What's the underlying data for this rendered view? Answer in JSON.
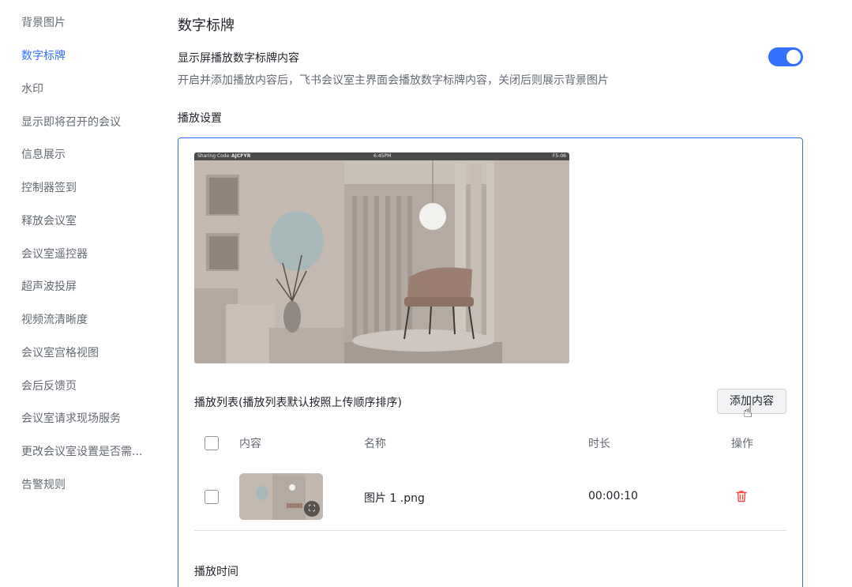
{
  "sidebar": {
    "items": [
      {
        "label": "背景图片"
      },
      {
        "label": "数字标牌"
      },
      {
        "label": "水印"
      },
      {
        "label": "显示即将召开的会议"
      },
      {
        "label": "信息展示"
      },
      {
        "label": "控制器签到"
      },
      {
        "label": "释放会议室"
      },
      {
        "label": "会议室遥控器"
      },
      {
        "label": "超声波投屏"
      },
      {
        "label": "视频流清晰度"
      },
      {
        "label": "会议室宫格视图"
      },
      {
        "label": "会后反馈页"
      },
      {
        "label": "会议室请求现场服务"
      },
      {
        "label": "更改会议室设置是否需..."
      },
      {
        "label": "告警规则"
      }
    ],
    "active_index": 1
  },
  "main": {
    "title": "数字标牌",
    "toggle": {
      "label": "显示屏播放数字标牌内容",
      "description": "开启并添加播放内容后，飞书会议室主界面会播放数字标牌内容，关闭后则展示背景图片",
      "on": true
    },
    "play_settings_title": "播放设置",
    "preview": {
      "sharing_code_label": "Sharing Code:",
      "sharing_code": "AJCFYR",
      "time": "6:45PM",
      "room": "F5-06"
    },
    "playlist": {
      "label": "播放列表(播放列表默认按照上传顺序排序)",
      "add_button": "添加内容",
      "columns": {
        "content": "内容",
        "name": "名称",
        "duration": "时长",
        "actions": "操作"
      },
      "rows": [
        {
          "name": "图片 1 .png",
          "duration": "00:00:10"
        }
      ]
    },
    "play_time_title": "播放时间"
  },
  "colors": {
    "accent": "#3370ff",
    "delete": "#f54a45"
  }
}
